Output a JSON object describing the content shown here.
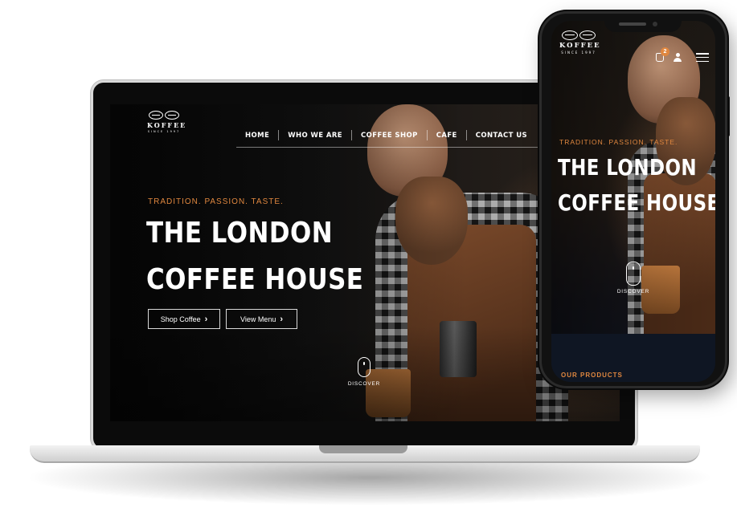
{
  "brand": {
    "name": "KOFFEE",
    "since": "SINCE 1997"
  },
  "desktop": {
    "nav": [
      "HOME",
      "WHO WE ARE",
      "COFFEE SHOP",
      "CAFE",
      "CONTACT US"
    ],
    "tagline": "TRADITION. PASSION. TASTE.",
    "headline_line1": "THE LONDON",
    "headline_line2": "COFFEE HOUSE",
    "buttons": {
      "shop": "Shop Coffee",
      "menu": "View Menu"
    },
    "discover": "DISCOVER"
  },
  "mobile": {
    "cart_count": "2",
    "tagline": "TRADITION. PASSION. TASTE.",
    "headline_line1": "THE LONDON",
    "headline_line2": "COFFEE HOUSE",
    "discover": "DISCOVER",
    "section_title": "OUR PRODUCTS"
  },
  "colors": {
    "accent": "#e0873f",
    "background": "#0b0b0b",
    "text": "#ffffff"
  },
  "icons": [
    "coffee-beans-logo-icon",
    "chevron-right-icon",
    "mouse-scroll-icon",
    "cart-icon",
    "user-icon",
    "hamburger-menu-icon"
  ]
}
